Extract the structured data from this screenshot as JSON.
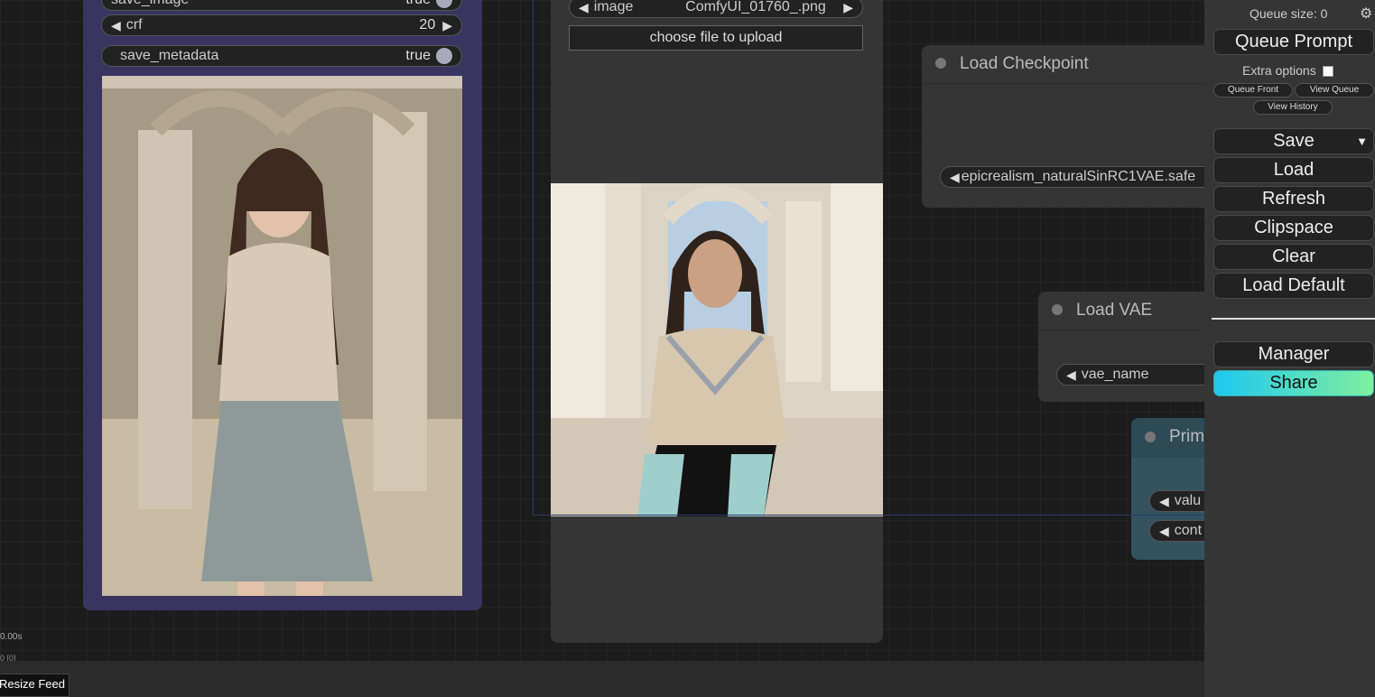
{
  "left_node": {
    "widgets": [
      {
        "label": "save_image",
        "value": "true"
      },
      {
        "label": "crf",
        "value": "20"
      },
      {
        "label": "save_metadata",
        "value": "true"
      }
    ]
  },
  "load_image_node": {
    "image_label": "image",
    "image_value": "ComfyUI_01760_.png",
    "upload_label": "choose file to upload"
  },
  "load_checkpoint": {
    "title": "Load Checkpoint",
    "ckpt_value": "epicrealism_naturalSinRC1VAE.safe"
  },
  "load_vae": {
    "title": "Load VAE",
    "vae_label": "vae_name"
  },
  "primitive": {
    "title": "Prim",
    "value_label": "valu",
    "control_label": "cont"
  },
  "menu": {
    "queue_size": "Queue size: 0",
    "queue_prompt": "Queue Prompt",
    "extra_options": "Extra options",
    "queue_front": "Queue Front",
    "view_queue": "View Queue",
    "view_history": "View History",
    "save": "Save",
    "load": "Load",
    "refresh": "Refresh",
    "clipspace": "Clipspace",
    "clear": "Clear",
    "load_default": "Load Default",
    "manager": "Manager",
    "share": "Share"
  },
  "footer": {
    "resize_feed": "Resize Feed",
    "time_stat": "0.00s",
    "time_stat2": "0 [0]"
  },
  "colors": {
    "canvas_bg": "#1c1c1c",
    "node_bg": "#353535",
    "save_node_bg": "#3a3460",
    "primitive_header": "#2e4a55",
    "share_gradient_start": "#1ec8f0",
    "share_gradient_end": "#7ef0a0"
  }
}
